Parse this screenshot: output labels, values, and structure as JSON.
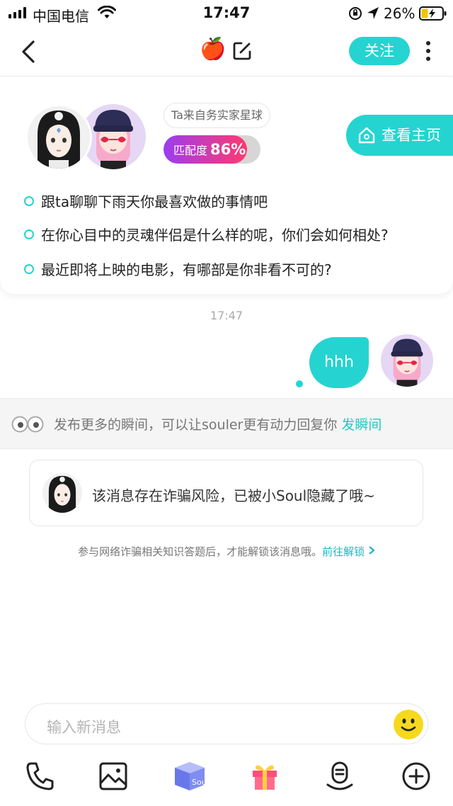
{
  "status_bar": {
    "carrier": "中国电信",
    "time": "17:47",
    "battery": "26%"
  },
  "nav": {
    "title_emoji": "🍎",
    "follow_label": "关注"
  },
  "profile_card": {
    "planet_tag": "Ta来自务实家星球",
    "match_label": "匹配度",
    "match_value": "86%",
    "match_fraction": 0.86,
    "home_button_label": "查看主页",
    "topics": [
      "跟ta聊聊下雨天你最喜欢做的事情吧",
      "在你心目中的灵魂伴侣是什么样的呢，你们会如何相处?",
      "最近即将上映的电影，有哪部是你非看不可的?"
    ]
  },
  "chat": {
    "timestamp": "17:47",
    "messages": [
      {
        "from": "me",
        "text": "hhh"
      }
    ]
  },
  "notice": {
    "text": "发布更多的瞬间，可以让souler更有动力回复你",
    "link": "发瞬间"
  },
  "hidden_message": {
    "text": "该消息存在诈骗风险，已被小Soul隐藏了哦~",
    "hint": "参与网络诈骗相关知识答题后，才能解锁该消息哦。",
    "unlock_link": "前往解锁"
  },
  "input": {
    "placeholder": "输入新消息"
  },
  "toolbar": {
    "soul_box_label": "Soul"
  },
  "colors": {
    "accent": "#25d4d0",
    "match_gradient_start": "#9a3df0",
    "match_gradient_end": "#ff3a6e"
  }
}
